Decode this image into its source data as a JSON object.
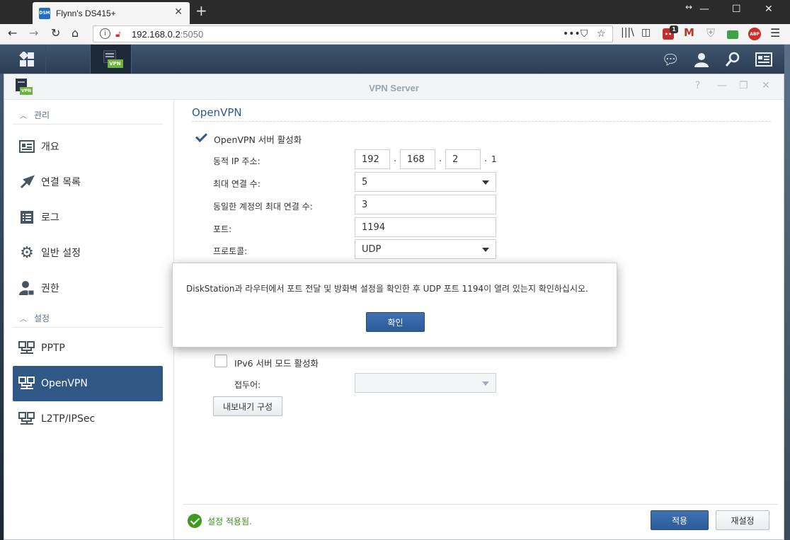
{
  "browser": {
    "tab_title": "Flynn's DS415+",
    "favicon_text": "DSM",
    "url_host": "192.168.0.2",
    "url_port": ":5050",
    "ext_badge": "1",
    "abp_label": "ABP"
  },
  "taskbar": {
    "vpn_label": "VPN"
  },
  "window": {
    "title": "VPN Server"
  },
  "sidebar": {
    "section_manage": "관리",
    "section_settings": "설정",
    "items": [
      {
        "label": "개요",
        "icon": "overview-icon"
      },
      {
        "label": "연결 목록",
        "icon": "connection-list-icon"
      },
      {
        "label": "로그",
        "icon": "log-icon"
      },
      {
        "label": "일반 설정",
        "icon": "gear-icon"
      },
      {
        "label": "권한",
        "icon": "permission-icon"
      }
    ],
    "settings_items": [
      {
        "label": "PPTP",
        "icon": "network-icon"
      },
      {
        "label": "OpenVPN",
        "icon": "network-icon",
        "active": true
      },
      {
        "label": "L2TP/IPSec",
        "icon": "network-icon"
      }
    ]
  },
  "form": {
    "section_title": "OpenVPN",
    "enable_label": "OpenVPN 서버 활성화",
    "enable_checked": true,
    "dynamic_ip_label": "동적 IP 주소:",
    "ip": [
      "192",
      "168",
      "2",
      "1"
    ],
    "max_conn_label": "최대 연결 수:",
    "max_conn_value": "5",
    "max_same_label": "동일한 계정의 최대 연결 수:",
    "max_same_value": "3",
    "port_label": "포트:",
    "port_value": "1194",
    "protocol_label": "프로토콜:",
    "protocol_value": "UDP",
    "ipv6_label": "IPv6 서버 모드 활성화",
    "ipv6_checked": false,
    "prefix_label": "접두어:",
    "prefix_value": "",
    "export_button": "내보내기 구성"
  },
  "footer": {
    "status_text": "설정 적용됨.",
    "apply_button": "적용",
    "reset_button": "재설정"
  },
  "dialog": {
    "message": "DiskStation과 라우터에서 포트 전달 및 방화벽 설정을 확인한 후 UDP 포트 1194이 열려 있는지 확인하십시오.",
    "ok_button": "확인"
  },
  "colors": {
    "accent": "#2f5887",
    "status_green": "#3e9b1f"
  }
}
